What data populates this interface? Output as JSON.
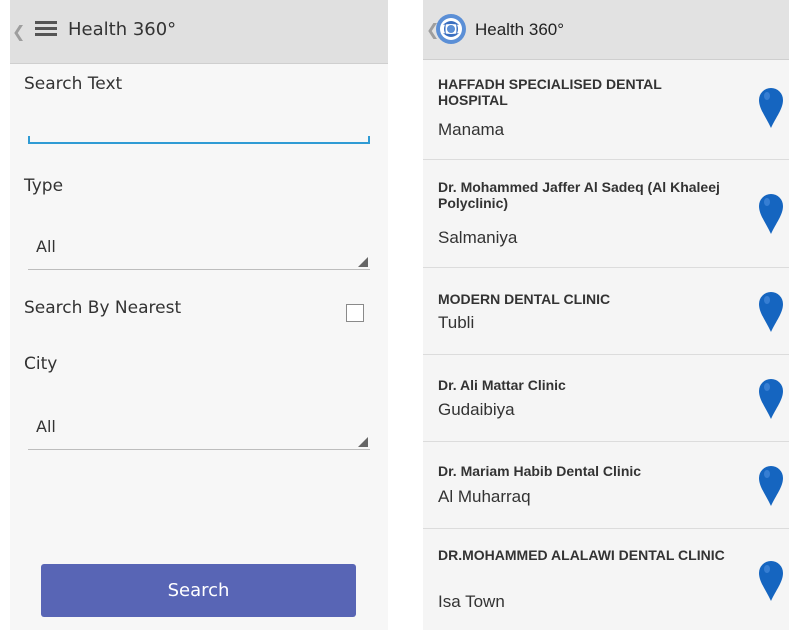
{
  "left": {
    "app_title": "Health 360°",
    "back_glyph": "❮",
    "search_label": "Search Text",
    "search_value": "",
    "type_label": "Type",
    "type_value": "All",
    "nearest_label": "Search By Nearest",
    "nearest_checked": false,
    "city_label": "City",
    "city_value": "All",
    "search_button": "Search"
  },
  "right": {
    "app_title": "Health 360°",
    "back_glyph": "❮",
    "pin_color": "#1565c0",
    "items": [
      {
        "name": "HAFFADH SPECIALISED DENTAL HOSPITAL",
        "city": "Manama"
      },
      {
        "name": "Dr. Mohammed Jaffer Al Sadeq (Al Khaleej Polyclinic)",
        "city": "Salmaniya"
      },
      {
        "name": "MODERN DENTAL CLINIC",
        "city": "Tubli"
      },
      {
        "name": "Dr. Ali Mattar Clinic",
        "city": "Gudaibiya"
      },
      {
        "name": "Dr. Mariam Habib Dental Clinic",
        "city": "Al Muharraq"
      },
      {
        "name": "DR.MOHAMMED ALALAWI DENTAL CLINIC",
        "city": "Isa Town"
      }
    ]
  },
  "icons": {
    "menu": "hamburger-menu-icon",
    "logo": "health-360-logo",
    "pin": "map-pin-icon",
    "dropdown": "dropdown-triangle-icon"
  }
}
